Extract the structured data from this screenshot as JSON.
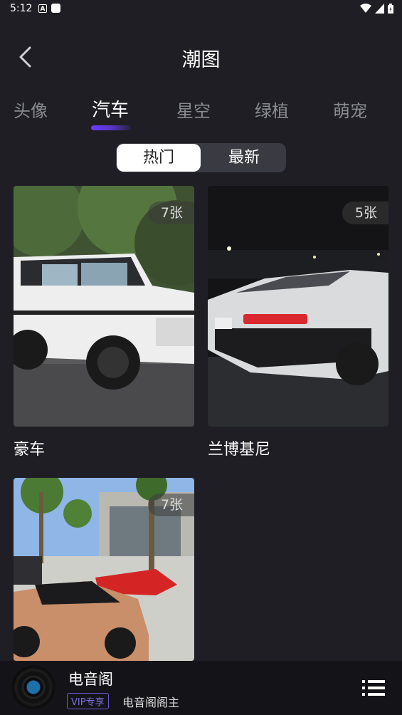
{
  "status_bar": {
    "time": "5:12"
  },
  "header": {
    "title": "潮图"
  },
  "tabs": [
    {
      "label": "头像"
    },
    {
      "label": "汽车"
    },
    {
      "label": "星空"
    },
    {
      "label": "绿植"
    },
    {
      "label": "萌宠"
    }
  ],
  "active_tab": "汽车",
  "segments": {
    "hot": "热门",
    "latest": "最新",
    "selected": "热门"
  },
  "cards": [
    {
      "name": "豪车",
      "count": "7张"
    },
    {
      "name": "兰博基尼",
      "count": "5张"
    },
    {
      "name": "",
      "count": "7张"
    }
  ],
  "player": {
    "song": "电音阁",
    "vip": "VIP专享",
    "artist": "电音阁阁主"
  },
  "colors": {
    "background": "#1e1e24",
    "accent": "#6a3cff",
    "player_bg": "#141418"
  }
}
